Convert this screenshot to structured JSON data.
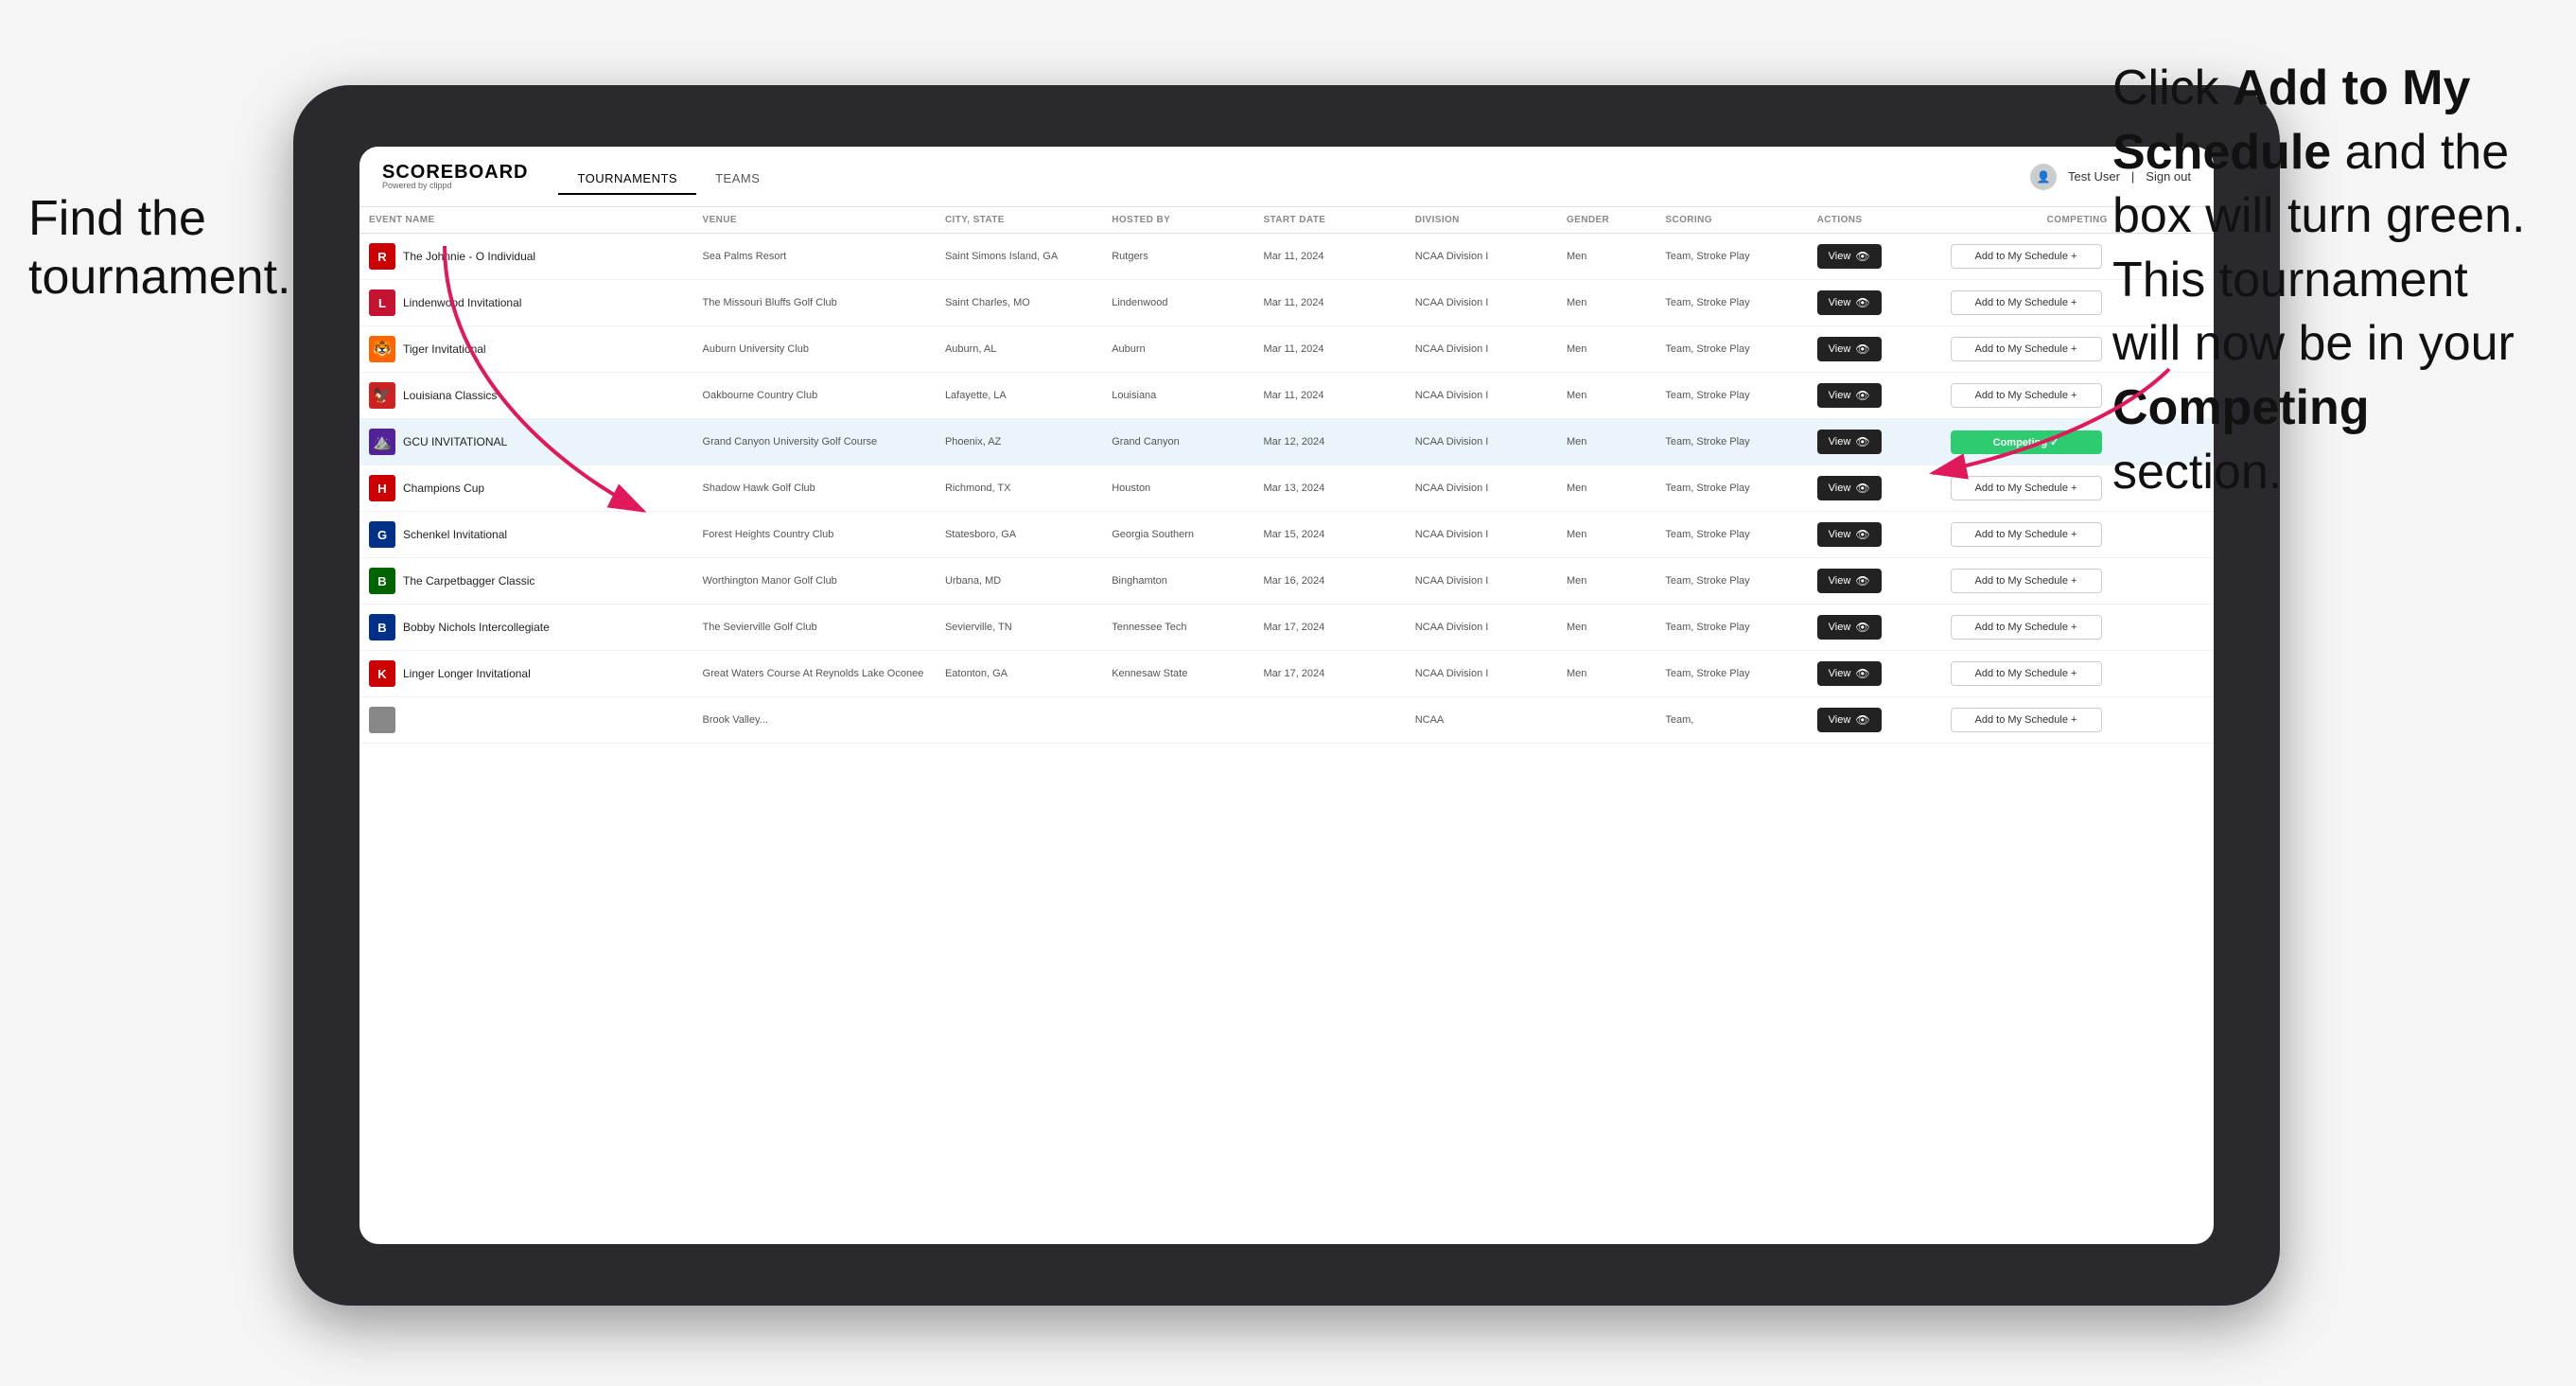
{
  "annotations": {
    "left": "Find the tournament.",
    "right_line1": "Click ",
    "right_bold1": "Add to My Schedule",
    "right_line2": " and the box will turn green. This tournament will now be in your ",
    "right_bold2": "Competing",
    "right_line3": " section."
  },
  "nav": {
    "logo": "SCOREBOARD",
    "logo_sub": "Powered by clippd",
    "tabs": [
      "TOURNAMENTS",
      "TEAMS"
    ],
    "active_tab": "TOURNAMENTS",
    "user": "Test User",
    "sign_out": "Sign out"
  },
  "table": {
    "columns": [
      "EVENT NAME",
      "VENUE",
      "CITY, STATE",
      "HOSTED BY",
      "START DATE",
      "DIVISION",
      "GENDER",
      "SCORING",
      "ACTIONS",
      "COMPETING"
    ],
    "rows": [
      {
        "id": 1,
        "logo_color": "#cc0000",
        "logo_text": "R",
        "event": "The Johnnie - O Individual",
        "venue": "Sea Palms Resort",
        "city": "Saint Simons Island, GA",
        "hosted": "Rutgers",
        "date": "Mar 11, 2024",
        "division": "NCAA Division I",
        "gender": "Men",
        "scoring": "Team, Stroke Play",
        "action": "View",
        "competing": "Add to My Schedule +",
        "is_competing": false,
        "highlighted": false
      },
      {
        "id": 2,
        "logo_color": "#c41230",
        "logo_text": "L",
        "event": "Lindenwood Invitational",
        "venue": "The Missouri Bluffs Golf Club",
        "city": "Saint Charles, MO",
        "hosted": "Lindenwood",
        "date": "Mar 11, 2024",
        "division": "NCAA Division I",
        "gender": "Men",
        "scoring": "Team, Stroke Play",
        "action": "View",
        "competing": "Add to My Schedule +",
        "is_competing": false,
        "highlighted": false
      },
      {
        "id": 3,
        "logo_color": "#ff6600",
        "logo_text": "🐯",
        "event": "Tiger Invitational",
        "venue": "Auburn University Club",
        "city": "Auburn, AL",
        "hosted": "Auburn",
        "date": "Mar 11, 2024",
        "division": "NCAA Division I",
        "gender": "Men",
        "scoring": "Team, Stroke Play",
        "action": "View",
        "competing": "Add to My Schedule +",
        "is_competing": false,
        "highlighted": false
      },
      {
        "id": 4,
        "logo_color": "#cc0000",
        "logo_text": "🦅",
        "event": "Louisiana Classics",
        "venue": "Oakbourne Country Club",
        "city": "Lafayette, LA",
        "hosted": "Louisiana",
        "date": "Mar 11, 2024",
        "division": "NCAA Division I",
        "gender": "Men",
        "scoring": "Team, Stroke Play",
        "action": "View",
        "competing": "Add to My Schedule +",
        "is_competing": false,
        "highlighted": false
      },
      {
        "id": 5,
        "logo_color": "#522398",
        "logo_text": "GCU",
        "event": "GCU INVITATIONAL",
        "venue": "Grand Canyon University Golf Course",
        "city": "Phoenix, AZ",
        "hosted": "Grand Canyon",
        "date": "Mar 12, 2024",
        "division": "NCAA Division I",
        "gender": "Men",
        "scoring": "Team, Stroke Play",
        "action": "View",
        "competing": "Competing ✓",
        "is_competing": true,
        "highlighted": true
      },
      {
        "id": 6,
        "logo_color": "#cc0000",
        "logo_text": "H",
        "event": "Champions Cup",
        "venue": "Shadow Hawk Golf Club",
        "city": "Richmond, TX",
        "hosted": "Houston",
        "date": "Mar 13, 2024",
        "division": "NCAA Division I",
        "gender": "Men",
        "scoring": "Team, Stroke Play",
        "action": "View",
        "competing": "Add to My Schedule +",
        "is_competing": false,
        "highlighted": false
      },
      {
        "id": 7,
        "logo_color": "#003087",
        "logo_text": "G",
        "event": "Schenkel Invitational",
        "venue": "Forest Heights Country Club",
        "city": "Statesboro, GA",
        "hosted": "Georgia Southern",
        "date": "Mar 15, 2024",
        "division": "NCAA Division I",
        "gender": "Men",
        "scoring": "Team, Stroke Play",
        "action": "View",
        "competing": "Add to My Schedule +",
        "is_competing": false,
        "highlighted": false
      },
      {
        "id": 8,
        "logo_color": "#006400",
        "logo_text": "B",
        "event": "The Carpetbagger Classic",
        "venue": "Worthington Manor Golf Club",
        "city": "Urbana, MD",
        "hosted": "Binghamton",
        "date": "Mar 16, 2024",
        "division": "NCAA Division I",
        "gender": "Men",
        "scoring": "Team, Stroke Play",
        "action": "View",
        "competing": "Add to My Schedule +",
        "is_competing": false,
        "highlighted": false
      },
      {
        "id": 9,
        "logo_color": "#003087",
        "logo_text": "B",
        "event": "Bobby Nichols Intercollegiate",
        "venue": "The Sevierville Golf Club",
        "city": "Sevierville, TN",
        "hosted": "Tennessee Tech",
        "date": "Mar 17, 2024",
        "division": "NCAA Division I",
        "gender": "Men",
        "scoring": "Team, Stroke Play",
        "action": "View",
        "competing": "Add to My Schedule +",
        "is_competing": false,
        "highlighted": false
      },
      {
        "id": 10,
        "logo_color": "#cc0000",
        "logo_text": "K",
        "event": "Linger Longer Invitational",
        "venue": "Great Waters Course At Reynolds Lake Oconee",
        "city": "Eatonton, GA",
        "hosted": "Kennesaw State",
        "date": "Mar 17, 2024",
        "division": "NCAA Division I",
        "gender": "Men",
        "scoring": "Team, Stroke Play",
        "action": "View",
        "competing": "Add to My Schedule +",
        "is_competing": false,
        "highlighted": false
      },
      {
        "id": 11,
        "logo_color": "#666",
        "logo_text": "?",
        "event": "",
        "venue": "Brook Valley...",
        "city": "",
        "hosted": "",
        "date": "",
        "division": "NCAA",
        "gender": "",
        "scoring": "Team,",
        "action": "View",
        "competing": "Add to My Schedule +",
        "is_competing": false,
        "highlighted": false
      }
    ]
  }
}
